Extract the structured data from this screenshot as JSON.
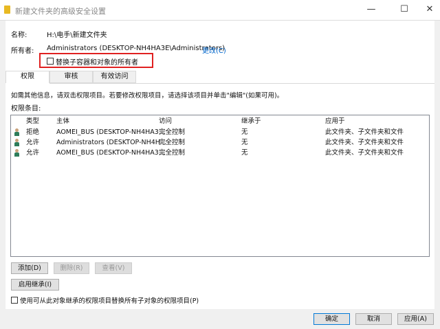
{
  "window": {
    "title": "新建文件夹的高级安全设置",
    "minimize": "—",
    "maximize": "☐",
    "close": "✕"
  },
  "name_label": "名称:",
  "name_value": "H:\\电手\\新建文件夹",
  "owner_label": "所有者:",
  "owner_value": "Administrators (DESKTOP-NH4HA3E\\Administrators)",
  "change_link": "更改(C)",
  "replace_owner_checkbox": "替换子容器和对象的所有者",
  "tabs": [
    "权限",
    "审核",
    "有效访问"
  ],
  "info_text": "如需其他信息，请双击权限项目。若要修改权限项目，请选择该项目并单击\"编辑\"(如果可用)。",
  "entries_label": "权限条目:",
  "columns": [
    "类型",
    "主体",
    "访问",
    "继承于",
    "应用于"
  ],
  "rows": [
    {
      "type": "拒绝",
      "principal": "AOMEI_BUS (DESKTOP-NH4HA3...",
      "access": "完全控制",
      "inherited": "无",
      "applies": "此文件夹、子文件夹和文件",
      "icon": "user-icon"
    },
    {
      "type": "允许",
      "principal": "Administrators (DESKTOP-NH4H...",
      "access": "完全控制",
      "inherited": "无",
      "applies": "此文件夹、子文件夹和文件",
      "icon": "group-icon"
    },
    {
      "type": "允许",
      "principal": "AOMEI_BUS (DESKTOP-NH4HA3...",
      "access": "完全控制",
      "inherited": "无",
      "applies": "此文件夹、子文件夹和文件",
      "icon": "user-icon"
    }
  ],
  "buttons": {
    "add": "添加(D)",
    "remove": "删除(R)",
    "view": "查看(V)",
    "enable_inheritance": "启用继承(I)",
    "ok": "确定",
    "cancel": "取消",
    "apply": "应用(A)"
  },
  "replace_perms_checkbox": "使用可从此对象继承的权限项目替换所有子对象的权限项目(P)",
  "colors": {
    "highlight": "#e02020",
    "link": "#0066cc"
  }
}
